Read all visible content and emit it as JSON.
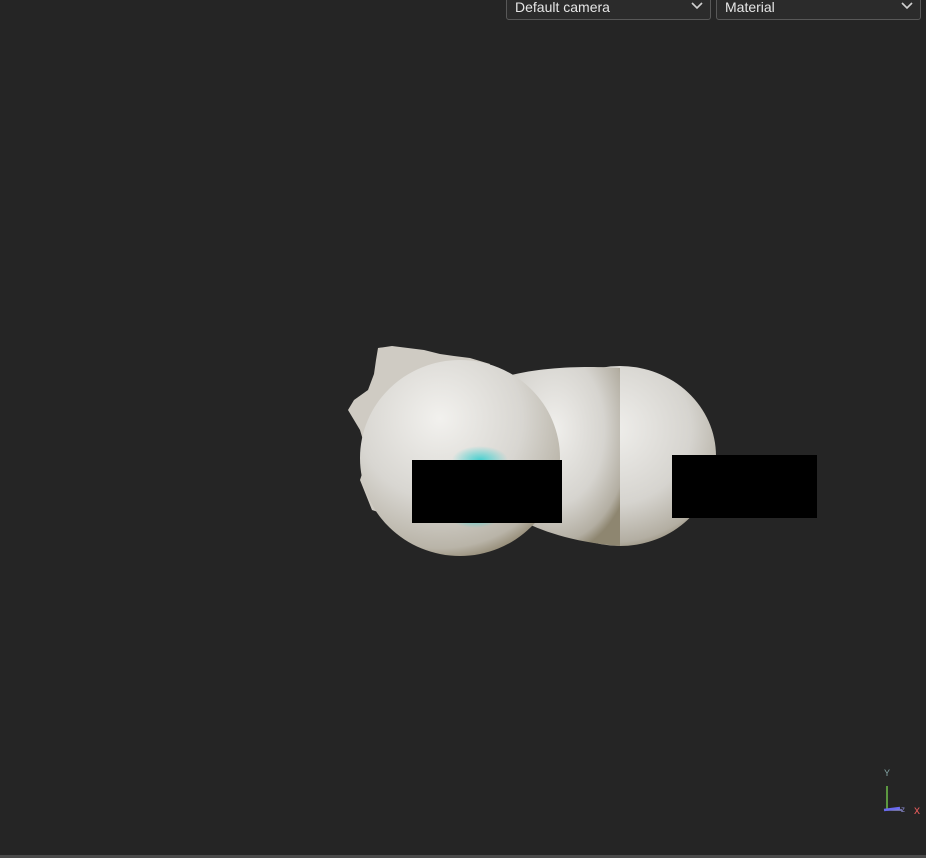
{
  "toolbar": {
    "camera_select": {
      "value": "Default camera",
      "icon": "chevron-down-icon"
    },
    "shading_select": {
      "value": "Material",
      "icon": "chevron-down-icon"
    }
  },
  "axes_gizmo": {
    "y_label": "Y",
    "z_label": "Z",
    "x_label": "X",
    "colors": {
      "x": "#e05a5a",
      "y": "#6fbf4a",
      "z": "#6a6af0"
    }
  },
  "colors": {
    "viewport_background": "#252525",
    "model_surface": "#d9d7d2",
    "highlight": "#3fd0d0",
    "redaction": "#000000"
  }
}
